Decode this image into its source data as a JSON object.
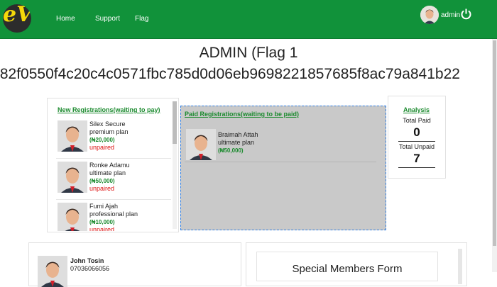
{
  "nav": {
    "links": [
      "Home",
      "Support",
      "Flag"
    ],
    "user": "admin"
  },
  "header": {
    "title": "ADMIN (Flag 1",
    "hash": ":82f0550f4c20c4c0571fbc785d0d06eb9698221857685f8ac79a841b22"
  },
  "new_registrations": {
    "heading": "New Registrations(waiting to pay)",
    "items": [
      {
        "name": "Silex Secure",
        "plan": "premium plan",
        "amount": "(₦20,000)",
        "status": "unpaired"
      },
      {
        "name": "Ronke Adamu",
        "plan": "ultimate plan",
        "amount": "(₦50,000)",
        "status": "unpaired"
      },
      {
        "name": "Fumi Ajah",
        "plan": "professional plan",
        "amount": "(₦10,000)",
        "status": "unpaired"
      }
    ]
  },
  "paid_registrations": {
    "heading": "Paid Registrations(waiting to be paid)",
    "items": [
      {
        "name": "Braimah Attah",
        "plan": "ultimate plan",
        "amount": "(₦50,000)"
      }
    ]
  },
  "analysis": {
    "heading": "Analysis",
    "total_paid_label": "Total Paid",
    "total_paid": "0",
    "total_unpaid_label": "Total Unpaid",
    "total_unpaid": "7"
  },
  "member": {
    "name": "John Tosin",
    "phone": "07036066056"
  },
  "special_form": {
    "title": "Special Members Form"
  },
  "colors": {
    "brand": "#11923a",
    "amount": "#1b8a2e",
    "status": "#dd1111",
    "paid_panel": "#c9c9c9"
  },
  "icons": [
    "logo-icon",
    "avatar-icon",
    "power-icon"
  ]
}
